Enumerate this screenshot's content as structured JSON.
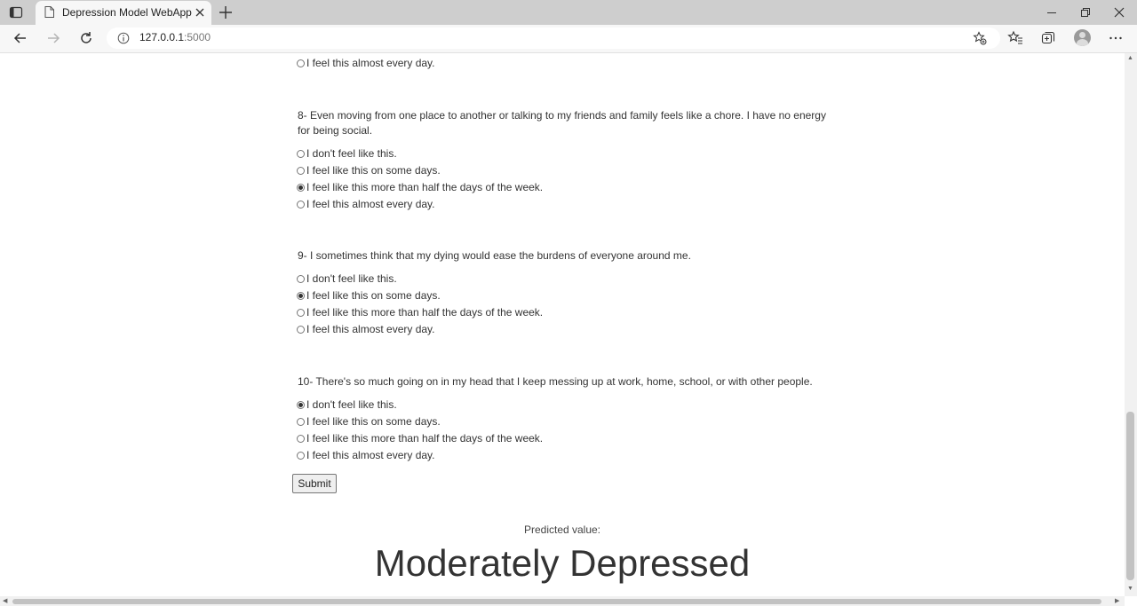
{
  "browser": {
    "tab_title": "Depression Model WebApp",
    "url_host": "127.0.0.1",
    "url_port": ":5000"
  },
  "prev_question_last_option": "I feel this almost every day.",
  "questions": [
    {
      "text": "8- Even moving from one place to another or talking to my friends and family feels like a chore. I have no energy for being social.",
      "options": [
        "I don't feel like this.",
        "I feel like this on some days.",
        "I feel like this more than half the days of the week.",
        "I feel this almost every day."
      ],
      "selected_index": 2
    },
    {
      "text": "9- I sometimes think that my dying would ease the burdens of everyone around me.",
      "options": [
        "I don't feel like this.",
        "I feel like this on some days.",
        "I feel like this more than half the days of the week.",
        "I feel this almost every day."
      ],
      "selected_index": 1
    },
    {
      "text": "10- There's so much going on in my head that I keep messing up at work, home, school, or with other people.",
      "options": [
        "I don't feel like this.",
        "I feel like this on some days.",
        "I feel like this more than half the days of the week.",
        "I feel this almost every day."
      ],
      "selected_index": 0
    }
  ],
  "submit_label": "Submit",
  "prediction": {
    "label": "Predicted value:",
    "value": "Moderately Depressed"
  }
}
